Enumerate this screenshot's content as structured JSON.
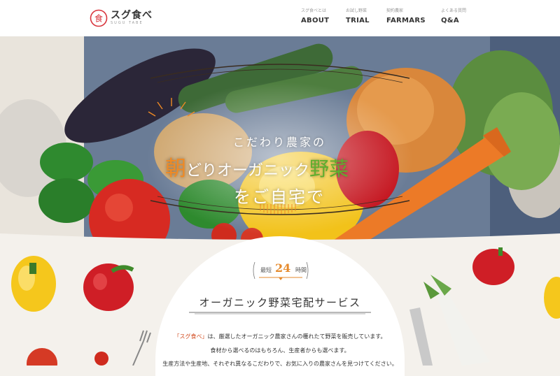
{
  "site": {
    "logo": {
      "mark": "食",
      "name": "スグ食べ",
      "sub": "SUGU TABE"
    }
  },
  "nav": [
    {
      "sub": "スグ食べとは",
      "label": "ABOUT"
    },
    {
      "sub": "お試し野菜",
      "label": "TRIAL"
    },
    {
      "sub": "契約農家",
      "label": "FARMARS"
    },
    {
      "sub": "よくある質問",
      "label": "Q&A"
    }
  ],
  "hero": {
    "line1": "こだわり農家の",
    "line2_a": "朝",
    "line2_b": "どりオーガニック",
    "line2_c": "野菜",
    "line3": "をご自宅で"
  },
  "intro": {
    "badge_pre": "最短",
    "badge_num": "24",
    "badge_post": "時間",
    "title": "オーガニック野菜宅配サービス",
    "desc1_highlight": "「スグ食べ」",
    "desc1_rest": "は、厳選したオーガニック農家さんの穫れたて野菜を販売しています。",
    "desc2": "食材から選べるのはもちろん、生産者からも選べます。",
    "desc3": "生産方法や生産地、それぞれ異なるこだわりで、お気に入りの農家さんを見つけてください。"
  },
  "colors": {
    "accent_orange": "#f08a24",
    "accent_green": "#5fae2e",
    "badge_orange": "#e58a2c",
    "highlight_red": "#d24b1f",
    "logo_red": "#d8343c"
  }
}
